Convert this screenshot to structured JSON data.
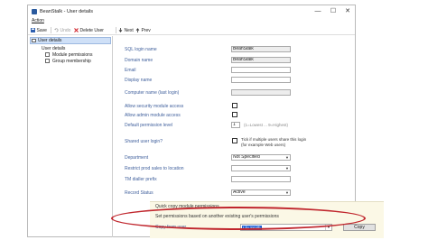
{
  "window": {
    "title": "BeanStalk - User details",
    "controls": {
      "minimize": "—",
      "maximize": "☐",
      "close": "✕"
    }
  },
  "menu": {
    "action": "Action"
  },
  "toolbar": {
    "save": "Save",
    "undo": "Undo",
    "delete_user": "Delete User",
    "next": "Next",
    "prev": "Prev"
  },
  "tree": {
    "header": "User details",
    "items": [
      "User details",
      "Module permissions",
      "Group membership"
    ]
  },
  "form": {
    "sql_login_name": {
      "label": "SQL login name",
      "value": "BeanStalk"
    },
    "domain_name": {
      "label": "Domain name",
      "value": "BeanStalk"
    },
    "email": {
      "label": "Email",
      "value": ""
    },
    "display_name": {
      "label": "Display name",
      "value": ""
    },
    "computer_name": {
      "label": "Computer name (last login)",
      "value": ""
    },
    "allow_security": {
      "label": "Allow security module access",
      "checked": false
    },
    "allow_admin": {
      "label": "Allow admin module access",
      "checked": false
    },
    "default_permission": {
      "label": "Default permission level",
      "value": "1",
      "hint": "(1=Lowest ... 9=Highest)"
    },
    "shared_user_login": {
      "label": "Shared user login?",
      "checked": false,
      "hint_line1": "Tick if multiple users share this login",
      "hint_line2": "(for example Web users)"
    },
    "department": {
      "label": "Department",
      "value": "Not Specified"
    },
    "restrict_prod_sales": {
      "label": "Restrict prod sales to location",
      "value": ""
    },
    "tm_dialler_prefix": {
      "label": "TM dialler prefix",
      "value": ""
    },
    "record_status": {
      "label": "Record Status",
      "value": "Active"
    }
  },
  "quick_copy": {
    "title": "Quick copy module permissions",
    "description": "Set permissions based on another existing user's permissions",
    "copy_from_label": "Copy from user",
    "copy_from_value": "Lily Smith",
    "copy_button": "Copy"
  },
  "colors": {
    "label_blue": "#3f5f9c",
    "selection_blue": "#1e63d6",
    "highlight_oval": "#c0262d",
    "section_bg": "#fbf8e6"
  }
}
